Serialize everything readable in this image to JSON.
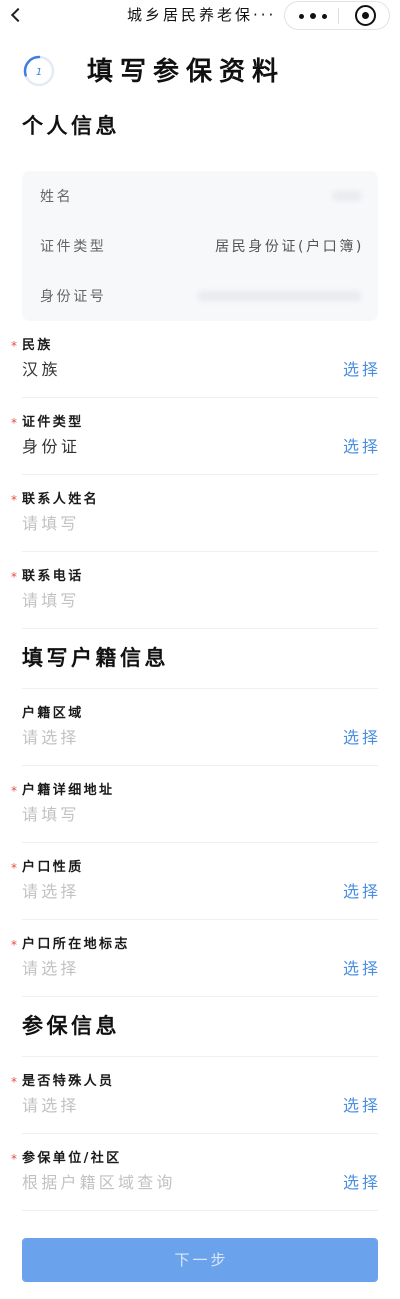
{
  "nav": {
    "title": "城乡居民养老保···",
    "icons": {
      "back": "back-icon",
      "more": "more-icon",
      "close": "target-icon"
    }
  },
  "header": {
    "step": "1",
    "progress_fraction": 0.3,
    "title": "填写参保资料"
  },
  "required_mark": "*",
  "personal": {
    "title": "个人信息",
    "card_rows": [
      {
        "label": "姓名"
      },
      {
        "label": "证件类型",
        "value": "居民身份证(户口簿)"
      },
      {
        "label": "身份证号"
      }
    ],
    "fields": [
      {
        "label": "民族",
        "required": true,
        "value": "汉族",
        "action": "选择"
      },
      {
        "label": "证件类型",
        "required": true,
        "value": "身份证",
        "action": "选择"
      },
      {
        "label": "联系人姓名",
        "required": true,
        "placeholder": "请填写"
      },
      {
        "label": "联系电话",
        "required": true,
        "placeholder": "请填写"
      }
    ]
  },
  "household": {
    "title": "填写户籍信息",
    "fields": [
      {
        "label": "户籍区域",
        "required": false,
        "placeholder": "请选择",
        "action": "选择"
      },
      {
        "label": "户籍详细地址",
        "required": true,
        "placeholder": "请填写"
      },
      {
        "label": "户口性质",
        "required": true,
        "placeholder": "请选择",
        "action": "选择"
      },
      {
        "label": "户口所在地标志",
        "required": true,
        "placeholder": "请选择",
        "action": "选择"
      }
    ]
  },
  "insurance": {
    "title": "参保信息",
    "fields": [
      {
        "label": "是否特殊人员",
        "required": true,
        "placeholder": "请选择",
        "action": "选择"
      },
      {
        "label": "参保单位/社区",
        "required": true,
        "placeholder": "根据户籍区域查询",
        "action": "选择"
      }
    ]
  },
  "next_button": "下一步",
  "colors": {
    "accent": "#4a8fe0",
    "required": "#e54d42",
    "button": "#6aa3ec",
    "progress": "#3d7fe0"
  }
}
